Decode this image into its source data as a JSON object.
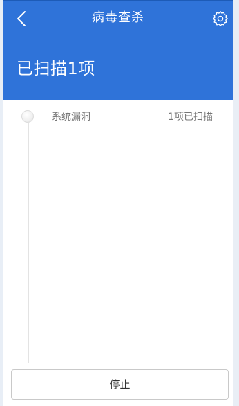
{
  "header": {
    "title": "病毒查杀",
    "back_icon": "chevron-left-icon",
    "settings_icon": "gear-icon",
    "scan_status": "已扫描1项"
  },
  "list": {
    "items": [
      {
        "name": "系统漏洞",
        "status": "1项已扫描"
      }
    ]
  },
  "footer": {
    "stop_label": "停止"
  },
  "colors": {
    "header_bg": "#2f73d9",
    "text_gray": "#777777",
    "border": "#c9c9c9"
  }
}
